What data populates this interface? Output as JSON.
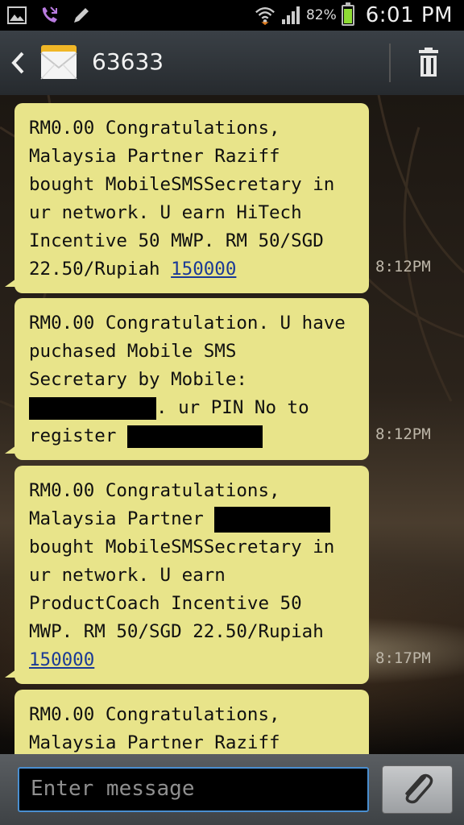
{
  "status_bar": {
    "battery_percent": "82%",
    "time": "6:01 PM"
  },
  "header": {
    "contact": "63633"
  },
  "messages": [
    {
      "lines": [
        "RM0.00 Congratulations,",
        "Malaysia Partner Raziff",
        "bought MobileSMSSecretary in",
        "ur network. U earn HiTech",
        "Incentive 50 MWP. RM 50/SGD",
        "22.50/Rupiah "
      ],
      "link": "150000",
      "time": "8:12PM"
    },
    {
      "line1": "RM0.00 Congratulation. U have",
      "line2": "puchased Mobile SMS",
      "line3": "Secretary by Mobile:",
      "line4_after": ". ur PIN No to",
      "line5": "register ",
      "time": "8:12PM"
    },
    {
      "line1": "RM0.00 Congratulations,",
      "line2": "Malaysia Partner ",
      "line3": "bought MobileSMSSecretary in",
      "line4": "ur network. U earn",
      "line5": "ProductCoach Incentive 50",
      "line6": "MWP. RM 50/SGD 22.50/Rupiah",
      "link": "150000",
      "time": "8:17PM"
    },
    {
      "line1": "RM0.00 Congratulations,",
      "line2": "Malaysia Partner Raziff"
    }
  ],
  "composer": {
    "placeholder": "Enter message"
  }
}
